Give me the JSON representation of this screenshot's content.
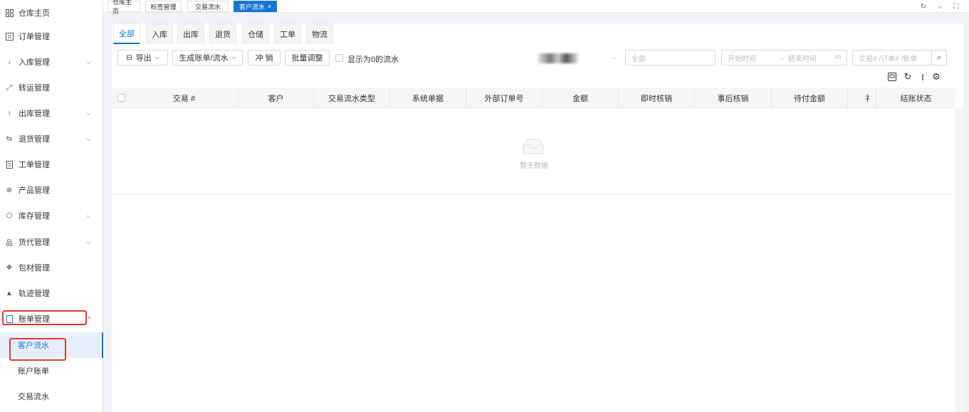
{
  "sidebar": {
    "items": [
      {
        "label": "仓库主页",
        "icon": "grid-icon",
        "has_children": false
      },
      {
        "label": "订单管理",
        "icon": "order-icon",
        "has_children": false
      },
      {
        "label": "入库管理",
        "icon": "arrow-down-icon",
        "has_children": true
      },
      {
        "label": "转运管理",
        "icon": "transfer-icon",
        "has_children": false
      },
      {
        "label": "出库管理",
        "icon": "arrow-up-icon",
        "has_children": true
      },
      {
        "label": "退货管理",
        "icon": "return-icon",
        "has_children": true
      },
      {
        "label": "工单管理",
        "icon": "workorder-icon",
        "has_children": false
      },
      {
        "label": "产品管理",
        "icon": "product-icon",
        "has_children": false
      },
      {
        "label": "库存管理",
        "icon": "inventory-icon",
        "has_children": true
      },
      {
        "label": "货代管理",
        "icon": "forwarder-icon",
        "has_children": true
      },
      {
        "label": "包材管理",
        "icon": "packaging-icon",
        "has_children": false
      },
      {
        "label": "轨迹管理",
        "icon": "track-icon",
        "has_children": false
      },
      {
        "label": "账单管理",
        "icon": "bill-icon",
        "has_children": true,
        "expanded": true
      }
    ],
    "sub_items": [
      {
        "label": "客户流水",
        "active": true
      },
      {
        "label": "账户账单",
        "active": false
      },
      {
        "label": "交易流水",
        "active": false
      }
    ]
  },
  "tabbar": {
    "tabs": [
      {
        "label": "仓库主页",
        "active": false
      },
      {
        "label": "标签管理",
        "active": false
      },
      {
        "label": "交易流水",
        "active": false
      },
      {
        "label": "客户流水",
        "active": true,
        "close": "×"
      }
    ],
    "controls": {
      "refresh": "↻",
      "dropdown": "⌵",
      "fullscreen": "⛶"
    }
  },
  "subtabs": [
    "全部",
    "入库",
    "出库",
    "退货",
    "仓储",
    "工单",
    "物流"
  ],
  "toolbar": {
    "export_label": "导出",
    "generate_label": "生成账单/流水",
    "reverse_label": "冲 销",
    "batch_adjust_label": "批量调整",
    "show_zero_label": "显示为0的流水",
    "status_select_value": "全部",
    "start_placeholder": "开始时间",
    "arrow": "→",
    "end_placeholder": "结束时间",
    "search_placeholder": "交易# /订单# /账单"
  },
  "table": {
    "columns": [
      "交易 #",
      "客户",
      "交易流水类型",
      "系统单据",
      "外部订单号",
      "金额",
      "即时核销",
      "事后核销",
      "待付金额",
      "",
      "结账状态"
    ],
    "partial_col_char": "礻",
    "empty_text": "暂无数据"
  }
}
